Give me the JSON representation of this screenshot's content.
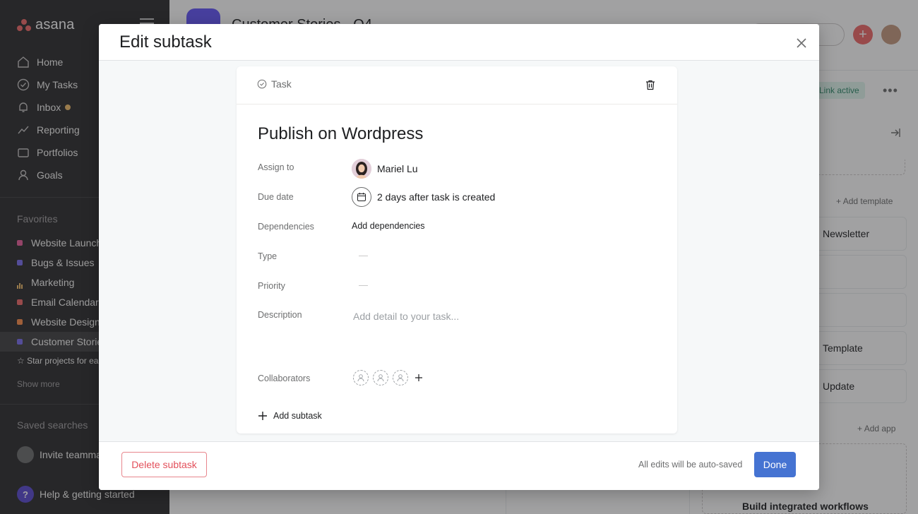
{
  "app": {
    "logo_text": "asana"
  },
  "sidebar": {
    "nav": [
      {
        "label": "Home",
        "icon": "home-icon"
      },
      {
        "label": "My Tasks",
        "icon": "check-circle-icon"
      },
      {
        "label": "Inbox",
        "icon": "bell-icon"
      },
      {
        "label": "Reporting",
        "icon": "chart-line-icon"
      },
      {
        "label": "Portfolios",
        "icon": "folder-icon"
      },
      {
        "label": "Goals",
        "icon": "person-icon"
      }
    ],
    "favorites_title": "Favorites",
    "favorites": [
      {
        "label": "Website Launch",
        "color": "#e8609b"
      },
      {
        "label": "Bugs & Issues",
        "color": "#7a6ff0"
      },
      {
        "label": "Marketing",
        "color": "#f1bd6c"
      },
      {
        "label": "Email Calendar",
        "color": "#f06a6a"
      },
      {
        "label": "Website Design",
        "color": "#fc8d4b"
      },
      {
        "label": "Customer Stories",
        "color": "#7a6ff0"
      }
    ],
    "star_projects": "Star projects for easy access",
    "show_more": "Show more",
    "saved_searches": "Saved searches",
    "invite": "Invite teammates",
    "help": "Help & getting started"
  },
  "project": {
    "title": "Customer Stories - Q4",
    "link_active": "Link active",
    "add_template": "Add template",
    "cards": [
      "Newsletter",
      "Template",
      "Update"
    ],
    "add_app": "Add app",
    "integrated": "Build integrated workflows"
  },
  "modal": {
    "title": "Edit subtask",
    "type_label": "Task",
    "task_title": "Publish on Wordpress",
    "fields": {
      "assign_to_label": "Assign to",
      "assignee": "Mariel Lu",
      "due_date_label": "Due date",
      "due_date": "2 days after task is created",
      "dependencies_label": "Dependencies",
      "dependencies_action": "Add dependencies",
      "type_label": "Type",
      "type_value": "—",
      "priority_label": "Priority",
      "priority_value": "—",
      "description_label": "Description",
      "description_placeholder": "Add detail to your task...",
      "collaborators_label": "Collaborators"
    },
    "add_subtask": "Add subtask",
    "delete_button": "Delete subtask",
    "autosave_note": "All edits will be auto-saved",
    "done_button": "Done"
  }
}
